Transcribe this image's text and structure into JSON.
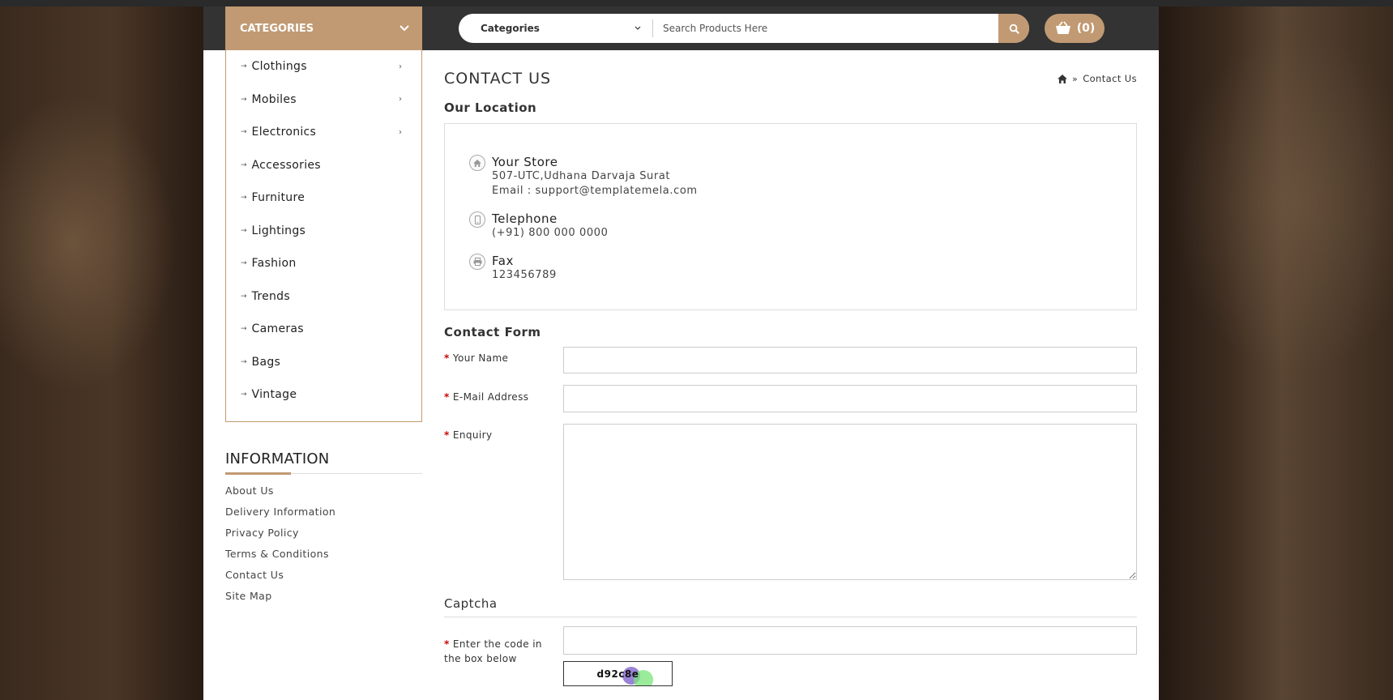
{
  "header": {
    "categories_label": "CATEGORIES",
    "search_category": "Categories",
    "search_placeholder": "Search Products Here",
    "cart_count": "(0)"
  },
  "sidebar": {
    "categories": [
      {
        "label": "Clothings",
        "has_sub": true
      },
      {
        "label": "Mobiles",
        "has_sub": true
      },
      {
        "label": "Electronics",
        "has_sub": true
      },
      {
        "label": "Accessories",
        "has_sub": false
      },
      {
        "label": "Furniture",
        "has_sub": false
      },
      {
        "label": "Lightings",
        "has_sub": false
      },
      {
        "label": "Fashion",
        "has_sub": false
      },
      {
        "label": "Trends",
        "has_sub": false
      },
      {
        "label": "Cameras",
        "has_sub": false
      },
      {
        "label": "Bags",
        "has_sub": false
      },
      {
        "label": "Vintage",
        "has_sub": false
      }
    ],
    "information_title": "INFORMATION",
    "information_links": [
      "About Us",
      "Delivery Information",
      "Privacy Policy",
      "Terms & Conditions",
      "Contact Us",
      "Site Map"
    ]
  },
  "main": {
    "page_title": "CONTACT US",
    "breadcrumb_current": "Contact Us",
    "our_location": "Our Location",
    "store_name": "Your Store",
    "store_address": "507-UTC,Udhana Darvaja Surat",
    "store_email": "Email : support@templatemela.com",
    "telephone_label": "Telephone",
    "telephone_value": "(+91) 800 000 0000",
    "fax_label": "Fax",
    "fax_value": "123456789",
    "contact_form": "Contact Form",
    "name_label": "Your Name",
    "email_label": "E-Mail Address",
    "enquiry_label": "Enquiry",
    "captcha_heading": "Captcha",
    "captcha_label_1": "Enter the code in",
    "captcha_label_2": "the box below",
    "captcha_code": "d92c8e"
  },
  "colors": {
    "accent": "#c19a73",
    "header": "#333333"
  }
}
